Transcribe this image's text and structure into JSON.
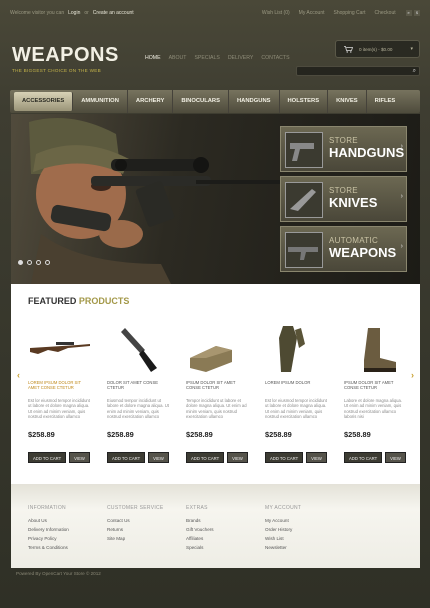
{
  "topbar": {
    "welcome": "Welcome visitor you can",
    "login": "Login",
    "or": "or",
    "create": "Create an account",
    "links": [
      "Wish List (0)",
      "My Account",
      "Shopping Cart",
      "Checkout"
    ],
    "flags": [
      "e",
      "$"
    ]
  },
  "header": {
    "logo": "WEAPONS",
    "tagline": "THE BIGGEST CHOICE ON THE WEB",
    "nav": [
      "HOME",
      "ABOUT",
      "SPECIALS",
      "DELIVERY",
      "CONTACTS"
    ],
    "cart": "0 item(s) - $0.00",
    "cart_icon": "cart-icon",
    "search_placeholder": ""
  },
  "categories": [
    "ACCESSORIES",
    "AMMUNITION",
    "ARCHERY",
    "BINOCULARS",
    "HANDGUNS",
    "HOLSTERS",
    "KNIVES",
    "RIFLES"
  ],
  "promos": [
    {
      "small": "STORE",
      "big": "HANDGUNS"
    },
    {
      "small": "STORE",
      "big": "KNIVES"
    },
    {
      "small": "AUTOMATIC",
      "big": "WEAPONS"
    }
  ],
  "featured": {
    "title_a": "FEATURED",
    "title_b": "PRODUCTS",
    "products": [
      {
        "name": "LOREM IPSUM DOLOR SIT AMET CONSE CTETUR",
        "desc": "Est lor eiusmod tempor incididunt ut labore et dolore magna aliqua. Ut enim ad minim veniam, quis nostrud exercitation ullamco",
        "price": "$258.89"
      },
      {
        "name": "DOLOR SIT AMET CONSE CTETUR",
        "desc": "Eiusmod tempor incididunt ut labore et dolore magna aliqua. Ut enim ad minim veniam, quis nostrud exercitation ullamco",
        "price": "$258.89"
      },
      {
        "name": "IPSUM DOLOR SIT AMET CONSE CTETUR",
        "desc": "Tempor incididunt ut labore et dolore magna aliqua. Ut enim ad minim veniam, quis nostrud exercitation ullamco",
        "price": "$258.89"
      },
      {
        "name": "LOREM IPSUM DOLOR",
        "desc": "Est lor eiusmod tempor incididunt ut labore et dolore magna aliqua. Ut enim ad minim veniam, quis nostrud exercitation ullamco",
        "price": "$258.89"
      },
      {
        "name": "IPSUM DOLOR SIT AMET CONSE CTETUR",
        "desc": "Labore et dolore magna aliqua. Ut enim ad minim veniam, quis nostrud exercitation ullamco laboris nisi",
        "price": "$258.89"
      }
    ],
    "add_label": "ADD TO CART",
    "view_label": "VIEW"
  },
  "footer": {
    "columns": [
      {
        "head": "INFORMATION",
        "items": [
          "About Us",
          "Delivery Information",
          "Privacy Policy",
          "Terms & Conditions"
        ]
      },
      {
        "head": "CUSTOMER SERVICE",
        "items": [
          "Contact Us",
          "Returns",
          "Site Map"
        ]
      },
      {
        "head": "EXTRAS",
        "items": [
          "Brands",
          "Gift Vouchers",
          "Affiliates",
          "Specials"
        ]
      },
      {
        "head": "MY ACCOUNT",
        "items": [
          "My Account",
          "Order History",
          "Wish List",
          "Newsletter"
        ]
      }
    ],
    "copyright": "Powered By OpenCart Your Store © 2012"
  }
}
